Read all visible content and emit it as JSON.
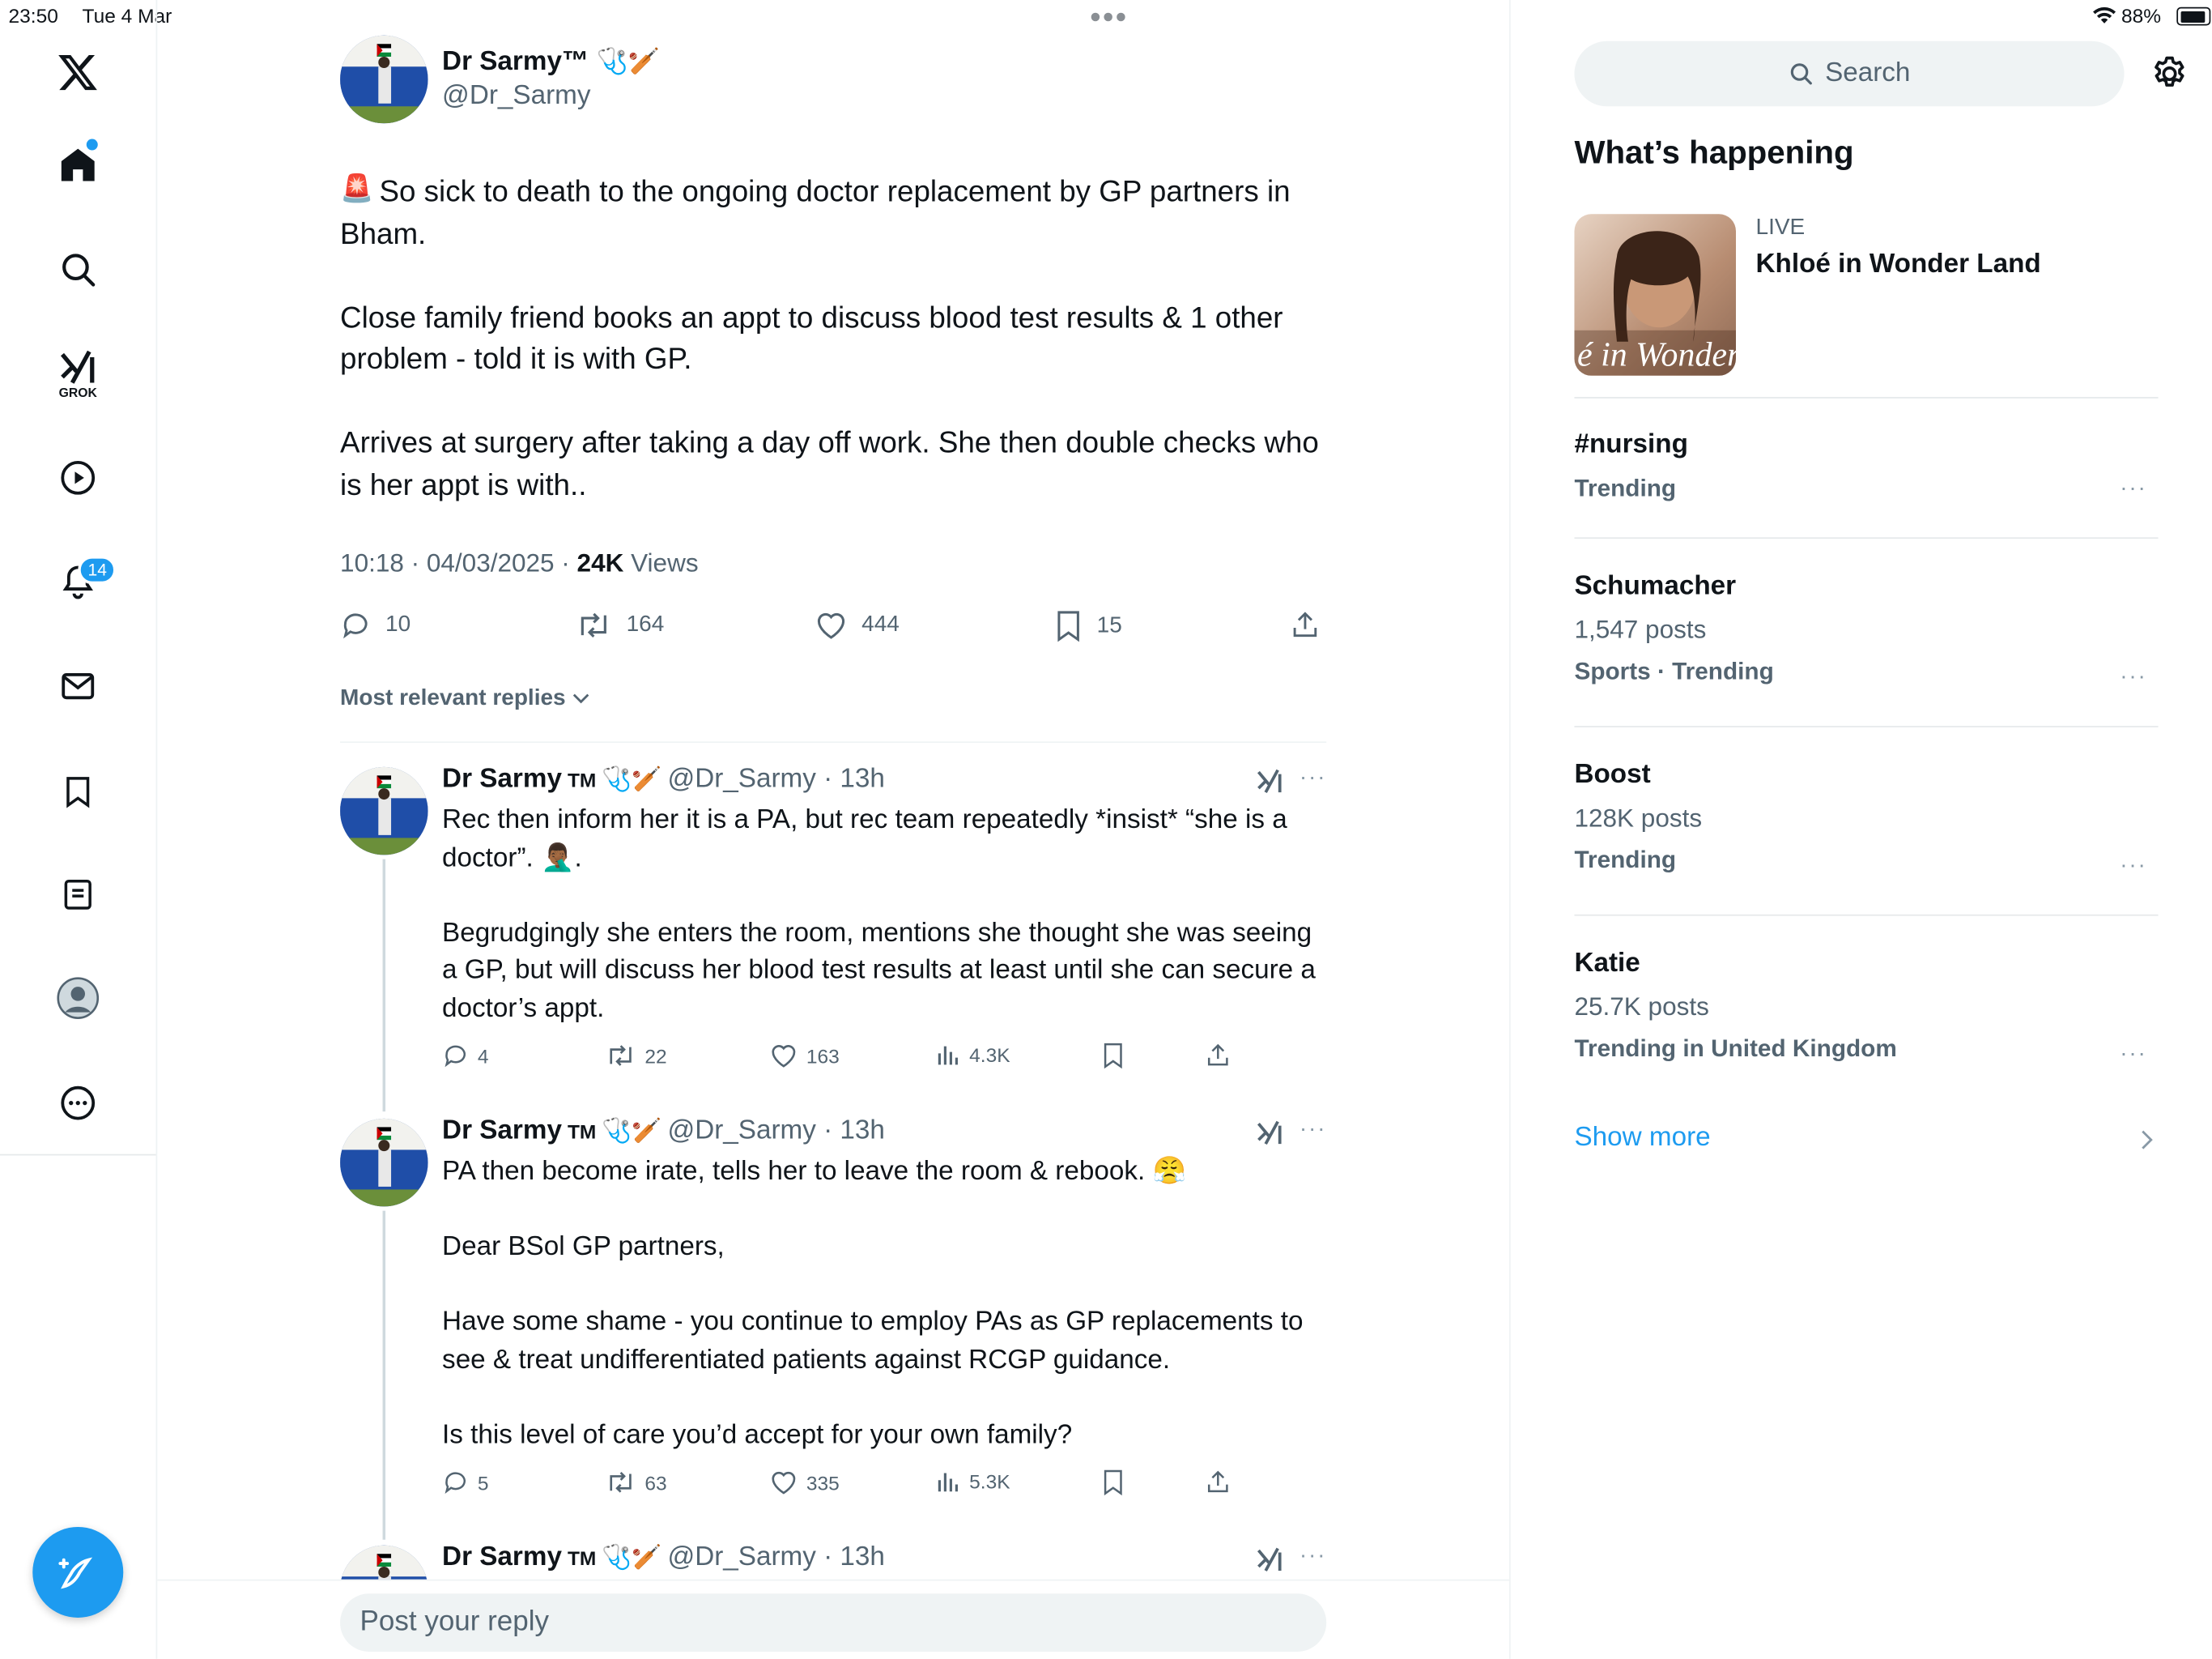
{
  "status_bar": {
    "time": "23:50",
    "date": "Tue 4 Mar",
    "battery": "88%"
  },
  "nav": {
    "grok_label": "GROK",
    "notifications_badge": "14"
  },
  "post": {
    "author_name": "Dr Sarmy™",
    "author_handle": "@Dr_Sarmy",
    "text": "So sick to death to the ongoing doctor replacement by GP partners in Bham.\n\nClose family friend books an appt to discuss blood test results & 1 other problem - told it is with GP.\n\nArrives at surgery after taking a day off work. She then double checks who is her appt is with..",
    "timestamp": "10:18 · 04/03/2025 · ",
    "views_count": "24K",
    "views_label": " Views",
    "replies": "10",
    "reposts": "164",
    "likes": "444",
    "bookmarks": "15",
    "sort_label": "Most relevant replies"
  },
  "replies": [
    {
      "author_name": "Dr Sarmy",
      "tm": "TM",
      "handle_time": "@Dr_Sarmy · 13h",
      "text": "Rec then inform her it is a PA, but rec team repeatedly *insist* “she is a doctor”. 🤦🏾‍♂️.\n\nBegrudgingly she enters the room, mentions she thought she was seeing a GP, but will discuss her blood test results at least until she can secure a doctor’s appt.",
      "replies": "4",
      "reposts": "22",
      "likes": "163",
      "views": "4.3K"
    },
    {
      "author_name": "Dr Sarmy",
      "tm": "TM",
      "handle_time": "@Dr_Sarmy · 13h",
      "text": "PA then become irate, tells her to leave the room & rebook. 😤\n\nDear BSol GP partners,\n\nHave some shame - you continue to employ PAs as GP replacements to see & treat undifferentiated patients against RCGP guidance.\n\nIs this level of care you’d accept for your own family?",
      "replies": "5",
      "reposts": "63",
      "likes": "335",
      "views": "5.3K"
    },
    {
      "author_name": "Dr Sarmy",
      "tm": "TM",
      "handle_time": "@Dr_Sarmy · 13h"
    }
  ],
  "reply_box": {
    "placeholder": "Post your reply"
  },
  "sidebar": {
    "search_label": "Search",
    "heading": "What’s happening",
    "live": {
      "badge": "LIVE",
      "title": "Khloé in Wonder Land",
      "thumb_text": "é in Wonder L"
    },
    "trends": [
      {
        "title": "#nursing",
        "posts": "",
        "meta": "Trending"
      },
      {
        "title": "Schumacher",
        "posts": "1,547 posts",
        "meta": "Sports · Trending"
      },
      {
        "title": "Boost",
        "posts": "128K posts",
        "meta": "Trending"
      },
      {
        "title": "Katie",
        "posts": "25.7K posts",
        "meta": "Trending in United Kingdom"
      }
    ],
    "show_more": "Show more"
  },
  "colors": {
    "accent": "#1d9bf0",
    "text": "#0f1419",
    "secondary": "#536471"
  }
}
